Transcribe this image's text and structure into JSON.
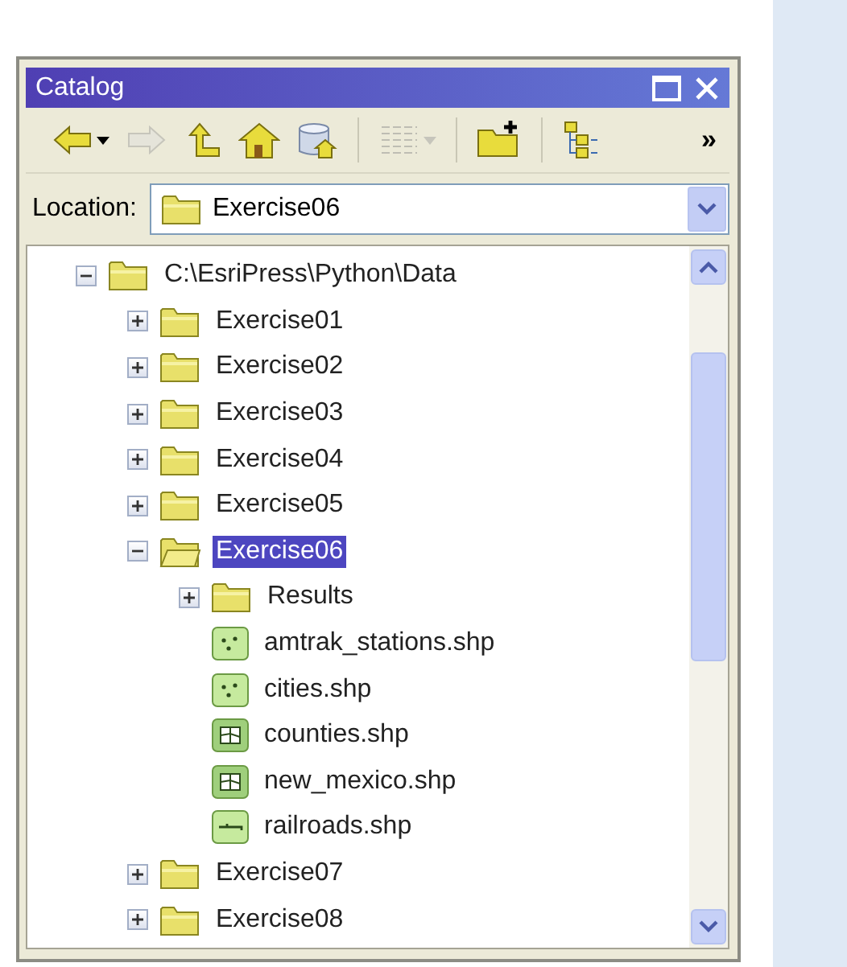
{
  "window": {
    "title": "Catalog"
  },
  "toolbar": {
    "buttons": [
      {
        "kind": "back",
        "disabled": false,
        "dropdown": true
      },
      {
        "kind": "forward",
        "disabled": true,
        "dropdown": false
      },
      {
        "kind": "up",
        "disabled": false,
        "dropdown": false
      },
      {
        "kind": "home",
        "disabled": false,
        "dropdown": false
      },
      {
        "kind": "database",
        "disabled": false,
        "dropdown": false
      },
      {
        "kind": "separator"
      },
      {
        "kind": "table",
        "disabled": true,
        "dropdown": true
      },
      {
        "kind": "separator"
      },
      {
        "kind": "connect",
        "disabled": false,
        "dropdown": false
      },
      {
        "kind": "separator"
      },
      {
        "kind": "tree",
        "disabled": false,
        "dropdown": false
      }
    ],
    "overflow": "»"
  },
  "location": {
    "label": "Location:",
    "value": "Exercise06"
  },
  "tree": [
    {
      "label": "C:\\EsriPress\\Python\\Data",
      "kind": "root",
      "expanded": true,
      "selected": false,
      "children": [
        {
          "label": "Exercise01",
          "kind": "folder",
          "expanded": false,
          "selected": false
        },
        {
          "label": "Exercise02",
          "kind": "folder",
          "expanded": false,
          "selected": false
        },
        {
          "label": "Exercise03",
          "kind": "folder",
          "expanded": false,
          "selected": false
        },
        {
          "label": "Exercise04",
          "kind": "folder",
          "expanded": false,
          "selected": false
        },
        {
          "label": "Exercise05",
          "kind": "folder",
          "expanded": false,
          "selected": false
        },
        {
          "label": "Exercise06",
          "kind": "folder",
          "expanded": true,
          "selected": true,
          "children": [
            {
              "label": "Results",
              "kind": "folder",
              "expanded": false,
              "selected": false
            },
            {
              "label": "amtrak_stations.shp",
              "kind": "point",
              "selected": false
            },
            {
              "label": "cities.shp",
              "kind": "point",
              "selected": false
            },
            {
              "label": "counties.shp",
              "kind": "polygon",
              "selected": false
            },
            {
              "label": "new_mexico.shp",
              "kind": "polygon",
              "selected": false
            },
            {
              "label": "railroads.shp",
              "kind": "line",
              "selected": false
            }
          ]
        },
        {
          "label": "Exercise07",
          "kind": "folder",
          "expanded": false,
          "selected": false
        },
        {
          "label": "Exercise08",
          "kind": "folder",
          "expanded": false,
          "selected": false
        }
      ]
    }
  ]
}
